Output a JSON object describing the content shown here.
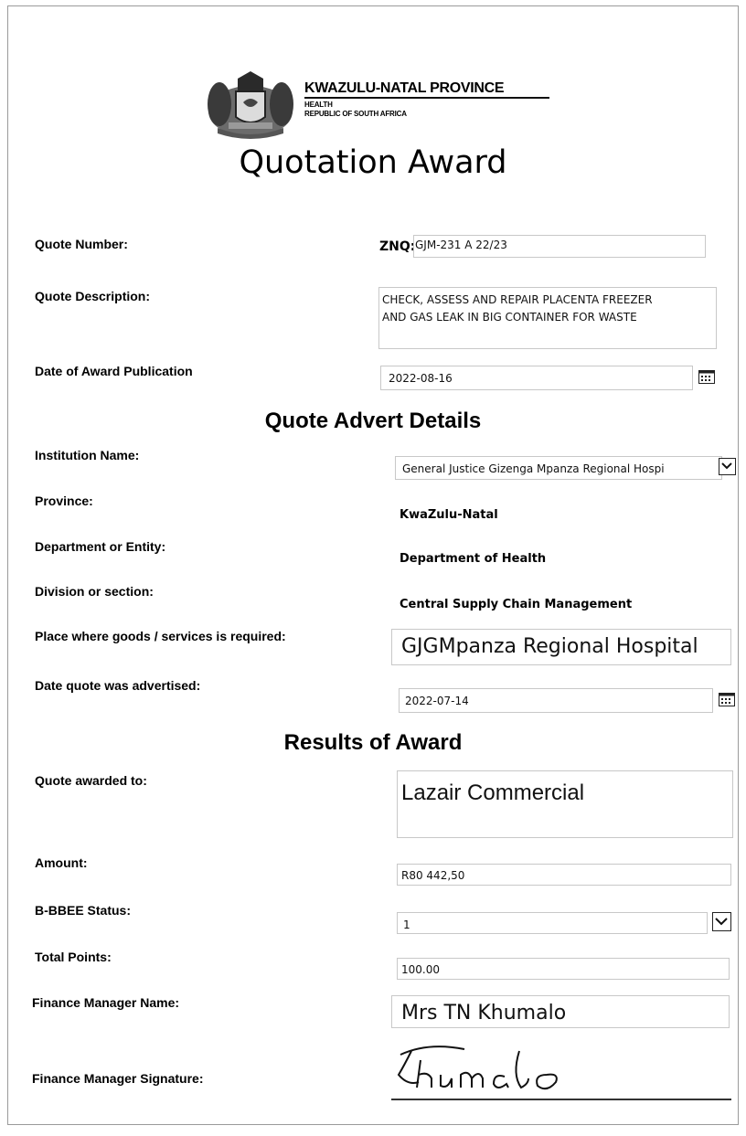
{
  "header": {
    "province": "KWAZULU-NATAL PROVINCE",
    "department": "HEALTH",
    "country": "REPUBLIC OF SOUTH AFRICA",
    "title": "Quotation Award"
  },
  "quote": {
    "number_label": "Quote Number:",
    "number_prefix": "ZNQ:",
    "number_value": "GJM-231 A 22/23",
    "description_label": "Quote Description:",
    "description_line1": "CHECK, ASSESS AND REPAIR PLACENTA FREEZER",
    "description_line2": "AND GAS LEAK IN BIG CONTAINER FOR WASTE",
    "publication_label": "Date of Award Publication",
    "publication_value": "2022-08-16"
  },
  "advert": {
    "section_title": "Quote Advert Details",
    "institution_label": "Institution Name:",
    "institution_value": "General Justice Gizenga Mpanza Regional Hospi",
    "province_label": "Province:",
    "province_value": "KwaZulu-Natal",
    "department_label": "Department or Entity:",
    "department_value": "Department of Health",
    "division_label": "Division or section:",
    "division_value": "Central Supply Chain Management",
    "place_label": "Place where goods /  services is required:",
    "place_value": "GJGMpanza Regional Hospital",
    "advertised_label": "Date quote was advertised:",
    "advertised_value": "2022-07-14"
  },
  "results": {
    "section_title": "Results of Award",
    "awarded_label": "Quote awarded to:",
    "awarded_value": "Lazair Commercial",
    "amount_label": "Amount:",
    "amount_value": "R80 442,50",
    "bbbee_label": "B-BBEE Status:",
    "bbbee_value": "1",
    "points_label": "Total Points:",
    "points_value": "100.00",
    "manager_label": "Finance Manager Name:",
    "manager_value": "Mrs TN Khumalo",
    "signature_label": "Finance Manager Signature:",
    "signature_text": "Khumalo"
  },
  "icons": {
    "calendar": "calendar-icon",
    "dropdown": "chevron-down-icon",
    "coat_of_arms": "coat-of-arms-logo"
  }
}
